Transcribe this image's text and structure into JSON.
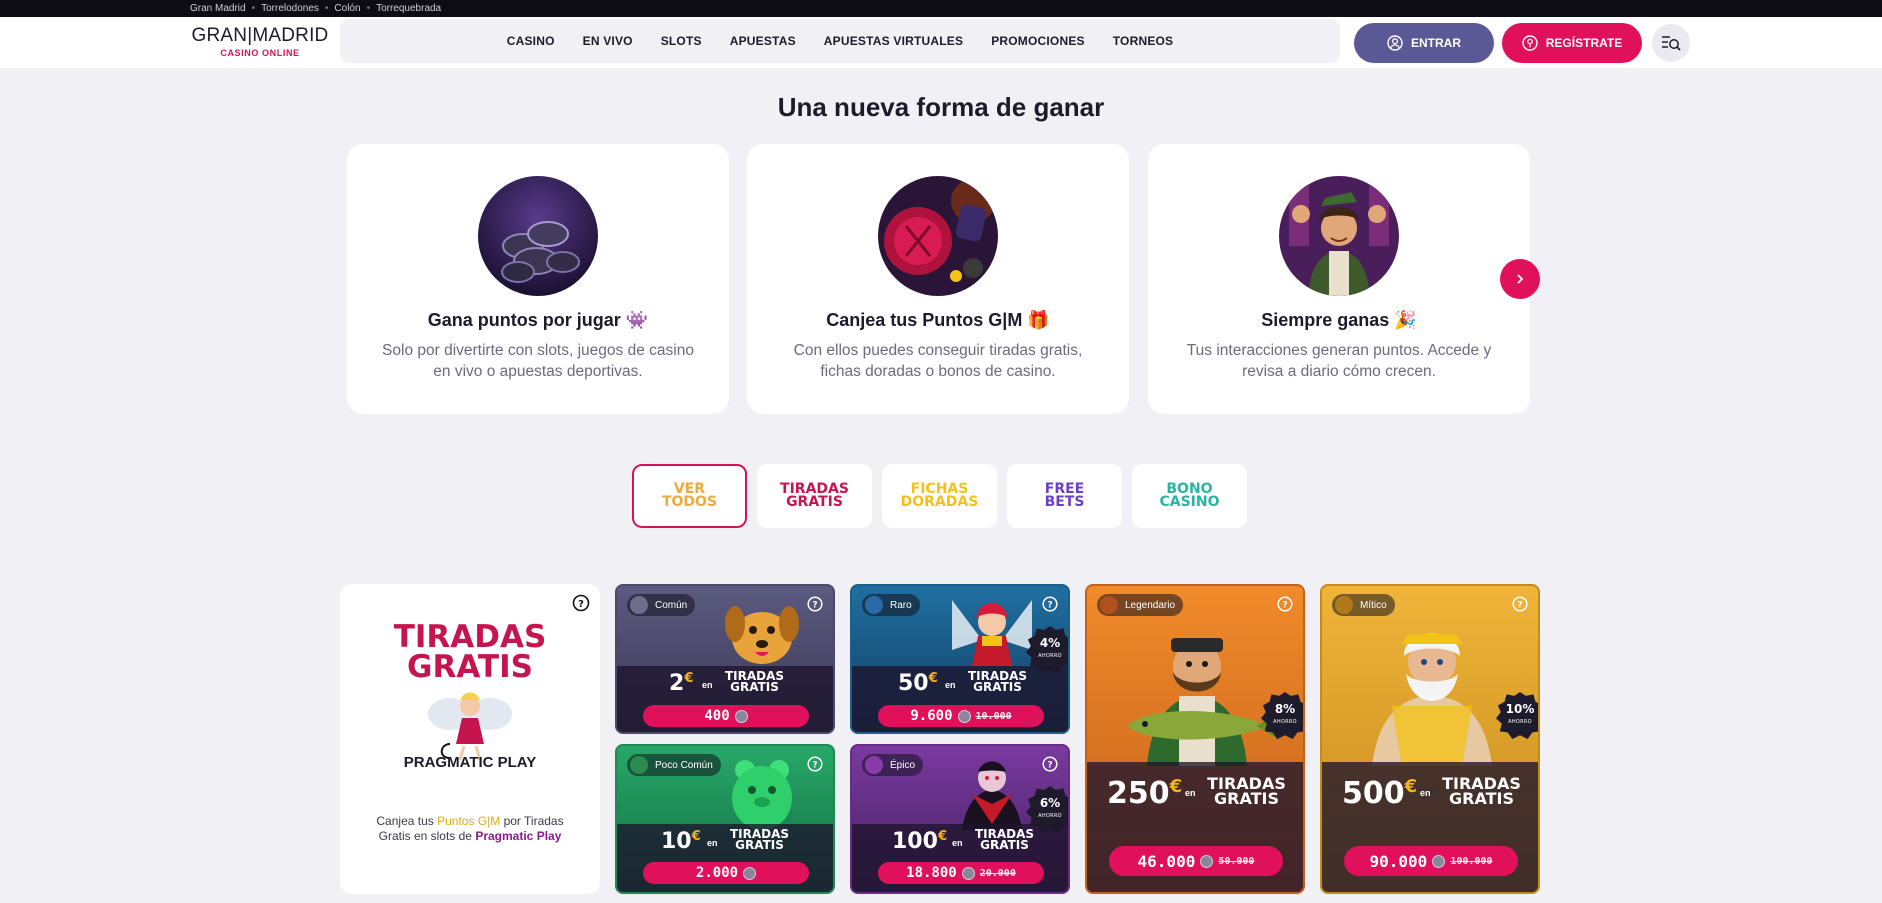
{
  "topbar": {
    "venues": [
      "Gran Madrid",
      "Torrelodones",
      "Colón",
      "Torrequebrada"
    ]
  },
  "header": {
    "logo_main": "GRAN|MADRID",
    "logo_sub": "CASINO ONLINE",
    "nav": [
      "CASINO",
      "EN VIVO",
      "SLOTS",
      "APUESTAS",
      "APUESTAS VIRTUALES",
      "PROMOCIONES",
      "TORNEOS"
    ],
    "login_label": "ENTRAR",
    "register_label": "REGÍSTRATE",
    "colors": {
      "login": "#5b5896",
      "register": "#e0105b"
    }
  },
  "section_title": "Una nueva forma de ganar",
  "features": [
    {
      "title": "Gana puntos por jugar 👾",
      "desc": "Solo por divertirte con slots, juegos de casino en vivo o apuestas deportivas."
    },
    {
      "title": "Canjea tus Puntos G|M 🎁",
      "desc": "Con ellos puedes conseguir tiradas gratis, fichas doradas o bonos de casino."
    },
    {
      "title": "Siempre ganas 🎉",
      "desc": "Tus interacciones generan puntos. Accede y revisa a diario cómo crecen."
    }
  ],
  "filters": [
    {
      "line1": "VER",
      "line2": "TODOS",
      "color": "#f0a93b",
      "active": true
    },
    {
      "line1": "TIRADAS",
      "line2": "GRATIS",
      "color": "#c4154f",
      "active": false
    },
    {
      "line1": "FICHAS",
      "line2": "DORADAS",
      "color": "#f2c21b",
      "active": false
    },
    {
      "line1": "FREE",
      "line2": "BETS",
      "color": "#6a3fc9",
      "active": false
    },
    {
      "line1": "BONO",
      "line2": "CASINO",
      "color": "#2bb3a6",
      "active": false
    }
  ],
  "promo": {
    "headline_1": "TIRADAS",
    "headline_2": "GRATIS",
    "brand": "PRAGMATIC PLAY",
    "text_before": "Canjea tus ",
    "text_points": "Puntos G|M",
    "text_middle": " por Tiradas Gratis en slots de ",
    "text_brand": "Pragmatic Play"
  },
  "rewards": [
    {
      "rarity": "Común",
      "amount": "2",
      "unit": "TIRADAS GRATIS",
      "en": "en",
      "price": "400",
      "old_price": "",
      "discount": ""
    },
    {
      "rarity": "Raro",
      "amount": "50",
      "unit": "TIRADAS GRATIS",
      "en": "en",
      "price": "9.600",
      "old_price": "10.000",
      "discount": "4%"
    },
    {
      "rarity": "Legendario",
      "amount": "250",
      "unit": "TIRADAS GRATIS",
      "en": "en",
      "price": "46.000",
      "old_price": "50.000",
      "discount": "8%"
    },
    {
      "rarity": "Mítico",
      "amount": "500",
      "unit": "TIRADAS GRATIS",
      "en": "en",
      "price": "90.000",
      "old_price": "100.000",
      "discount": "10%"
    },
    {
      "rarity": "Poco Común",
      "amount": "10",
      "unit": "TIRADAS GRATIS",
      "en": "en",
      "price": "2.000",
      "old_price": "",
      "discount": ""
    },
    {
      "rarity": "Épico",
      "amount": "100",
      "unit": "TIRADAS GRATIS",
      "en": "en",
      "price": "18.800",
      "old_price": "20.000",
      "discount": "6%"
    }
  ],
  "badge_sub": "AHORRO",
  "euro_symbol": "€"
}
